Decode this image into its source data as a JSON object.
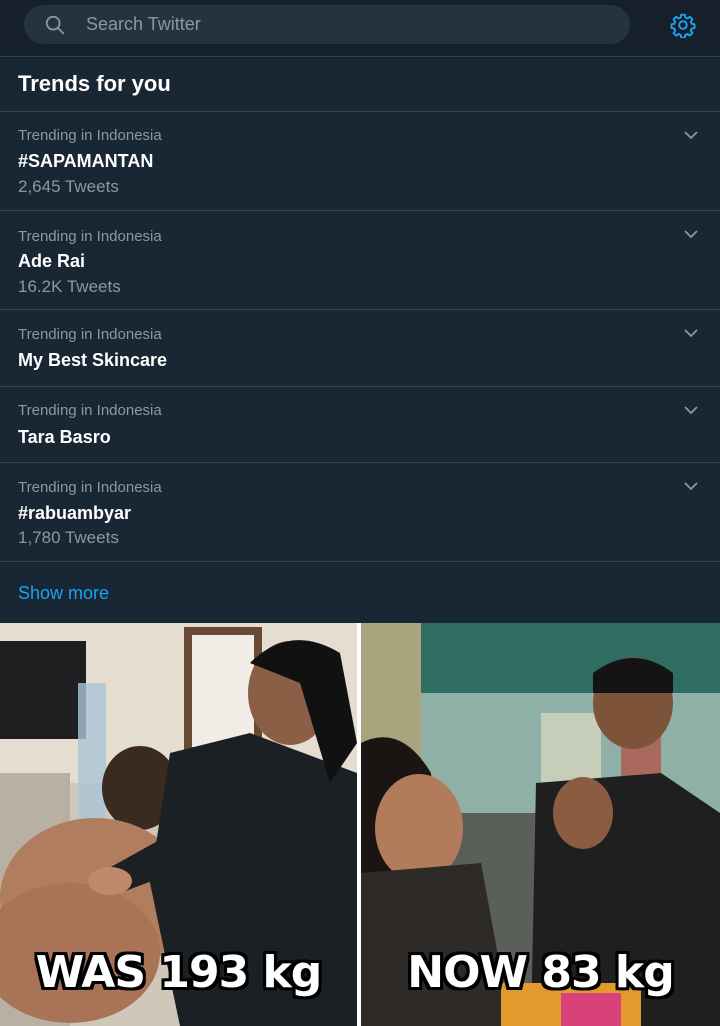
{
  "search": {
    "placeholder": "Search Twitter"
  },
  "trends": {
    "title": "Trends for you",
    "items": [
      {
        "context": "Trending in Indonesia",
        "name": "#SAPAMANTAN",
        "count": "2,645 Tweets"
      },
      {
        "context": "Trending in Indonesia",
        "name": "Ade Rai",
        "count": "16.2K Tweets"
      },
      {
        "context": "Trending in Indonesia",
        "name": "My Best Skincare",
        "count": ""
      },
      {
        "context": "Trending in Indonesia",
        "name": "Tara Basro",
        "count": ""
      },
      {
        "context": "Trending in Indonesia",
        "name": "#rabuambyar",
        "count": "1,780 Tweets"
      }
    ],
    "show_more": "Show more"
  },
  "photos": {
    "left_caption": "WAS 193 kg",
    "right_caption": "NOW 83 kg"
  },
  "colors": {
    "background": "#15202b",
    "panel": "#192734",
    "accent": "#1da1f2",
    "secondary_text": "#8899a6",
    "divider": "#38444d"
  },
  "icons": {
    "search": "search-icon",
    "settings": "gear-icon",
    "caret": "chevron-down-icon"
  }
}
